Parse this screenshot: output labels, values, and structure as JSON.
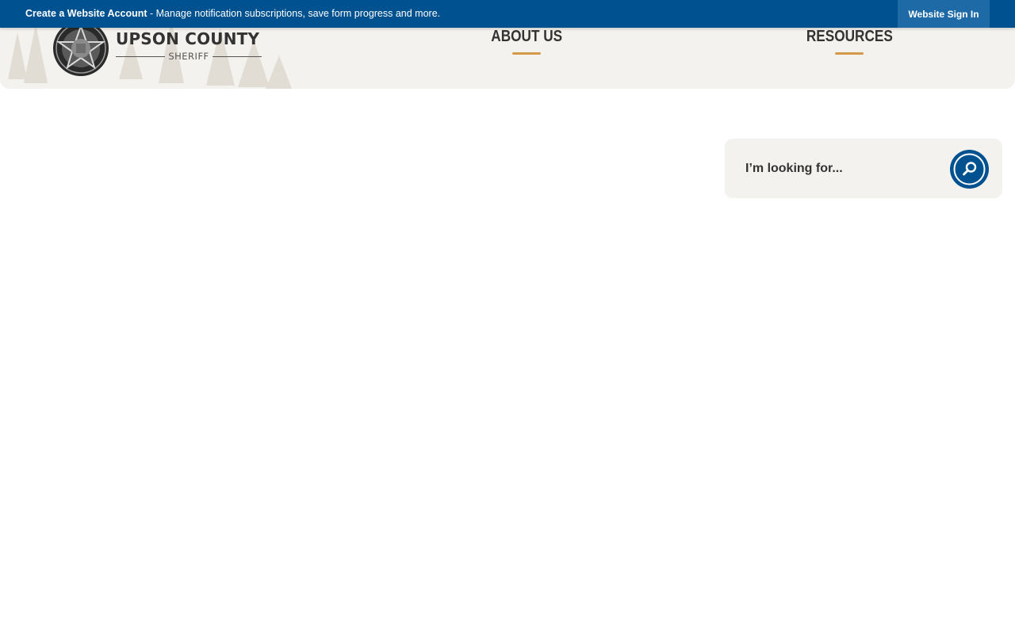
{
  "topbar": {
    "create_account_label": "Create a Website Account",
    "message": " - Manage notification subscriptions, save form progress and more.",
    "signin_label": "Website Sign In"
  },
  "logo": {
    "title": "UPSON COUNTY",
    "subtitle": "SHERIFF"
  },
  "nav": {
    "items": [
      {
        "label": "ABOUT US"
      },
      {
        "label": "RESOURCES"
      }
    ]
  },
  "search": {
    "placeholder": "I’m looking for..."
  },
  "colors": {
    "primary_blue": "#00518f",
    "accent_gold": "#d39a4a",
    "header_bg": "#f4f2ee"
  },
  "icons": {
    "search_button": "search-icon",
    "logo_seal": "sheriff-star-badge-icon"
  }
}
